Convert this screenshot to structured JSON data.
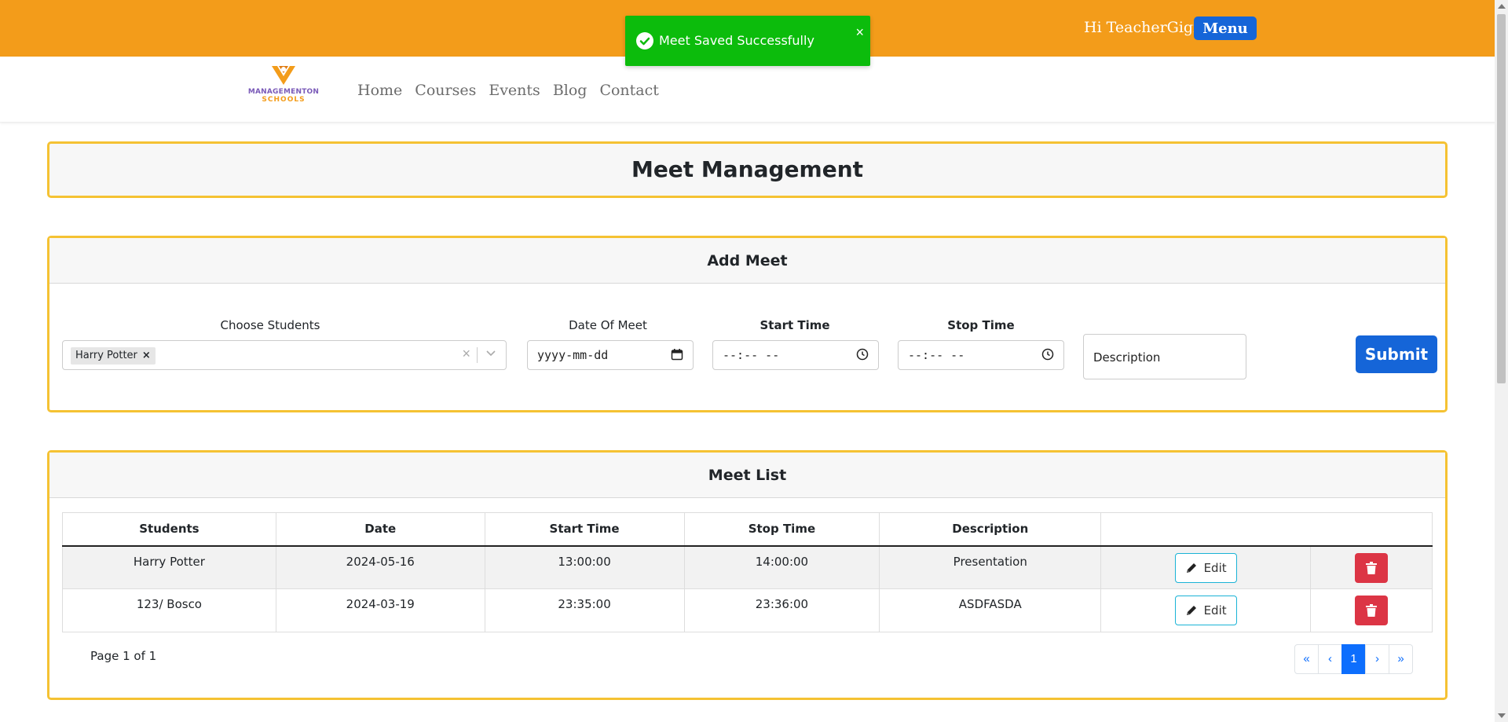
{
  "header": {
    "greeting": "Hi TeacherGigi",
    "menu_label": "Menu"
  },
  "toast": {
    "message": "Meet Saved Successfully",
    "close": "×"
  },
  "logo": {
    "line1": "MANAGEMENTON",
    "line2": "SCHOOLS"
  },
  "nav": {
    "items": [
      "Home",
      "Courses",
      "Events",
      "Blog",
      "Contact"
    ]
  },
  "page_title": "Meet Management",
  "add_meet": {
    "title": "Add Meet",
    "choose_students_label": "Choose Students",
    "selected_student": "Harry Potter",
    "date_label": "Date Of Meet",
    "date_placeholder": "yyyy-mm-dd",
    "start_label": "Start Time",
    "start_placeholder": "--:-- --",
    "stop_label": "Stop Time",
    "stop_placeholder": "--:-- --",
    "description_placeholder": "Description",
    "submit_label": "Submit"
  },
  "meet_list": {
    "title": "Meet List",
    "columns": [
      "Students",
      "Date",
      "Start Time",
      "Stop Time",
      "Description",
      ""
    ],
    "rows": [
      {
        "students": "Harry Potter",
        "date": "2024-05-16",
        "start": "13:00:00",
        "stop": "14:00:00",
        "description": "Presentation",
        "edit": "Edit"
      },
      {
        "students": "123/ Bosco",
        "date": "2024-03-19",
        "start": "23:35:00",
        "stop": "23:36:00",
        "description": "ASDFASDA",
        "edit": "Edit"
      }
    ],
    "page_info": "Page 1 of 1",
    "pager": [
      "«",
      "‹",
      "1",
      "›",
      "»"
    ]
  },
  "colors": {
    "topbar": "#f39c1a",
    "card_border": "#f5c233",
    "primary": "#1565d8",
    "toast": "#0cbc0c",
    "danger": "#dc3545"
  },
  "icons": [
    "check-circle-icon",
    "close-icon",
    "logo-mark-icon",
    "calendar-icon",
    "clock-icon",
    "pencil-icon",
    "trash-icon",
    "chevron-down-icon"
  ]
}
